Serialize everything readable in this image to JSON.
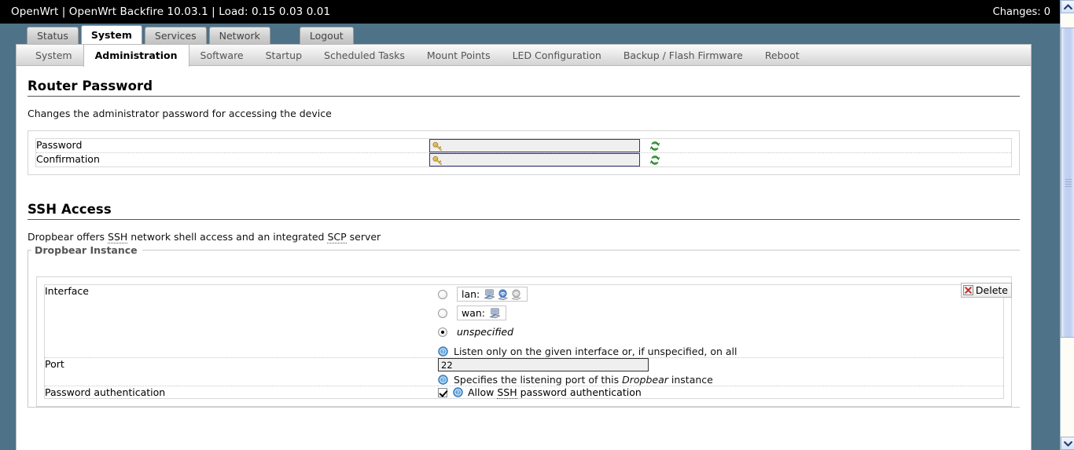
{
  "header": {
    "title": "OpenWrt | OpenWrt Backfire 10.03.1 | Load: 0.15 0.03 0.01",
    "changes_label": "Changes: 0"
  },
  "mainmenu": [
    {
      "label": "Status",
      "active": false
    },
    {
      "label": "System",
      "active": true
    },
    {
      "label": "Services",
      "active": false
    },
    {
      "label": "Network",
      "active": false
    },
    {
      "label": "Logout",
      "active": false
    }
  ],
  "tabmenu": [
    {
      "label": "System",
      "active": false
    },
    {
      "label": "Administration",
      "active": true
    },
    {
      "label": "Software",
      "active": false
    },
    {
      "label": "Startup",
      "active": false
    },
    {
      "label": "Scheduled Tasks",
      "active": false
    },
    {
      "label": "Mount Points",
      "active": false
    },
    {
      "label": "LED Configuration",
      "active": false
    },
    {
      "label": "Backup / Flash Firmware",
      "active": false
    },
    {
      "label": "Reboot",
      "active": false
    }
  ],
  "router_password": {
    "legend": "Router Password",
    "description": "Changes the administrator password for accessing the device",
    "password_label": "Password",
    "password_value": "",
    "confirmation_label": "Confirmation",
    "confirmation_value": ""
  },
  "ssh_access": {
    "legend": "SSH Access",
    "description_parts": {
      "a": "Dropbear offers ",
      "abbr1": "SSH",
      "b": " network shell access and an integrated ",
      "abbr2": "SCP",
      "c": " server"
    },
    "fieldset_legend": "Dropbear Instance",
    "delete_label": "Delete",
    "interface": {
      "label": "Interface",
      "options": [
        {
          "name": "lan:",
          "selected": false,
          "icons": [
            "ethernet-icon",
            "wifi-active-icon",
            "wifi-disabled-icon"
          ]
        },
        {
          "name": "wan:",
          "selected": false,
          "icons": [
            "ethernet-icon"
          ]
        },
        {
          "name": "unspecified",
          "selected": true,
          "icons": []
        }
      ],
      "hint": "Listen only on the given interface or, if unspecified, on all"
    },
    "port": {
      "label": "Port",
      "value": "22",
      "hint_a": "Specifies the listening port of this ",
      "hint_em": "Dropbear",
      "hint_b": " instance"
    },
    "password_auth": {
      "label": "Password authentication",
      "checked": true,
      "hint_a": "Allow ",
      "hint_abbr": "SSH",
      "hint_b": " password authentication"
    }
  },
  "icons": {
    "key": "key-icon",
    "reload": "reload-icon",
    "help": "help-icon",
    "delete_x": "red-x-icon",
    "scroll_up": "chevron-up-icon",
    "scroll_down": "chevron-down-icon"
  },
  "colors": {
    "page_border": "#4e7287",
    "header_bg": "#000000",
    "accent_blue": "#3b7fc4",
    "delete_red": "#cc2222",
    "reload_green": "#2f9e2f",
    "key_gold": "#e8c14a"
  }
}
